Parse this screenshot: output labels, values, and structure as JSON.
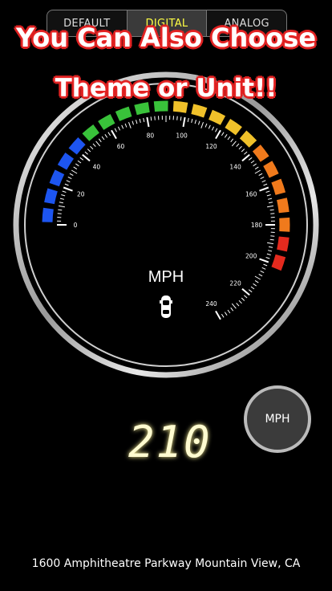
{
  "tabs": [
    {
      "label": "DEFAULT",
      "active": false
    },
    {
      "label": "DIGITAL",
      "active": true
    },
    {
      "label": "ANALOG",
      "active": false
    }
  ],
  "promo": {
    "line1": "You Can Also Choose",
    "line2": "Theme or Unit!!"
  },
  "gauge": {
    "unit_label": "MPH",
    "min": 0,
    "max": 240,
    "tick_labels": [
      "0",
      "20",
      "40",
      "60",
      "80",
      "100",
      "120",
      "140",
      "160",
      "180",
      "200",
      "220",
      "240"
    ],
    "current_speed": 210,
    "icon": "car-icon"
  },
  "speed_display": "210",
  "unit_button": "MPH",
  "address": "1600 Amphitheatre Parkway Mountain View, CA",
  "colors": {
    "blue": "#1d55f0",
    "green": "#39c23a",
    "yellow": "#f0c12a",
    "orange": "#f07a1c",
    "red": "#e42a1e",
    "digital": "#fffbd0",
    "active_tab": "#ffff44"
  }
}
